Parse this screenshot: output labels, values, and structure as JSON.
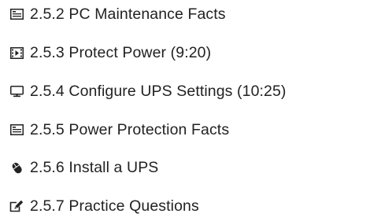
{
  "toc": {
    "items": [
      {
        "icon": "text-document-icon",
        "label": "2.5.2 PC Maintenance Facts"
      },
      {
        "icon": "video-icon",
        "label": "2.5.3 Protect Power (9:20)"
      },
      {
        "icon": "monitor-icon",
        "label": "2.5.4 Configure UPS Settings (10:25)"
      },
      {
        "icon": "text-document-icon",
        "label": "2.5.5 Power Protection Facts"
      },
      {
        "icon": "mouse-icon",
        "label": "2.5.6 Install a UPS"
      },
      {
        "icon": "practice-questions-icon",
        "label": "2.5.7 Practice Questions"
      }
    ]
  }
}
